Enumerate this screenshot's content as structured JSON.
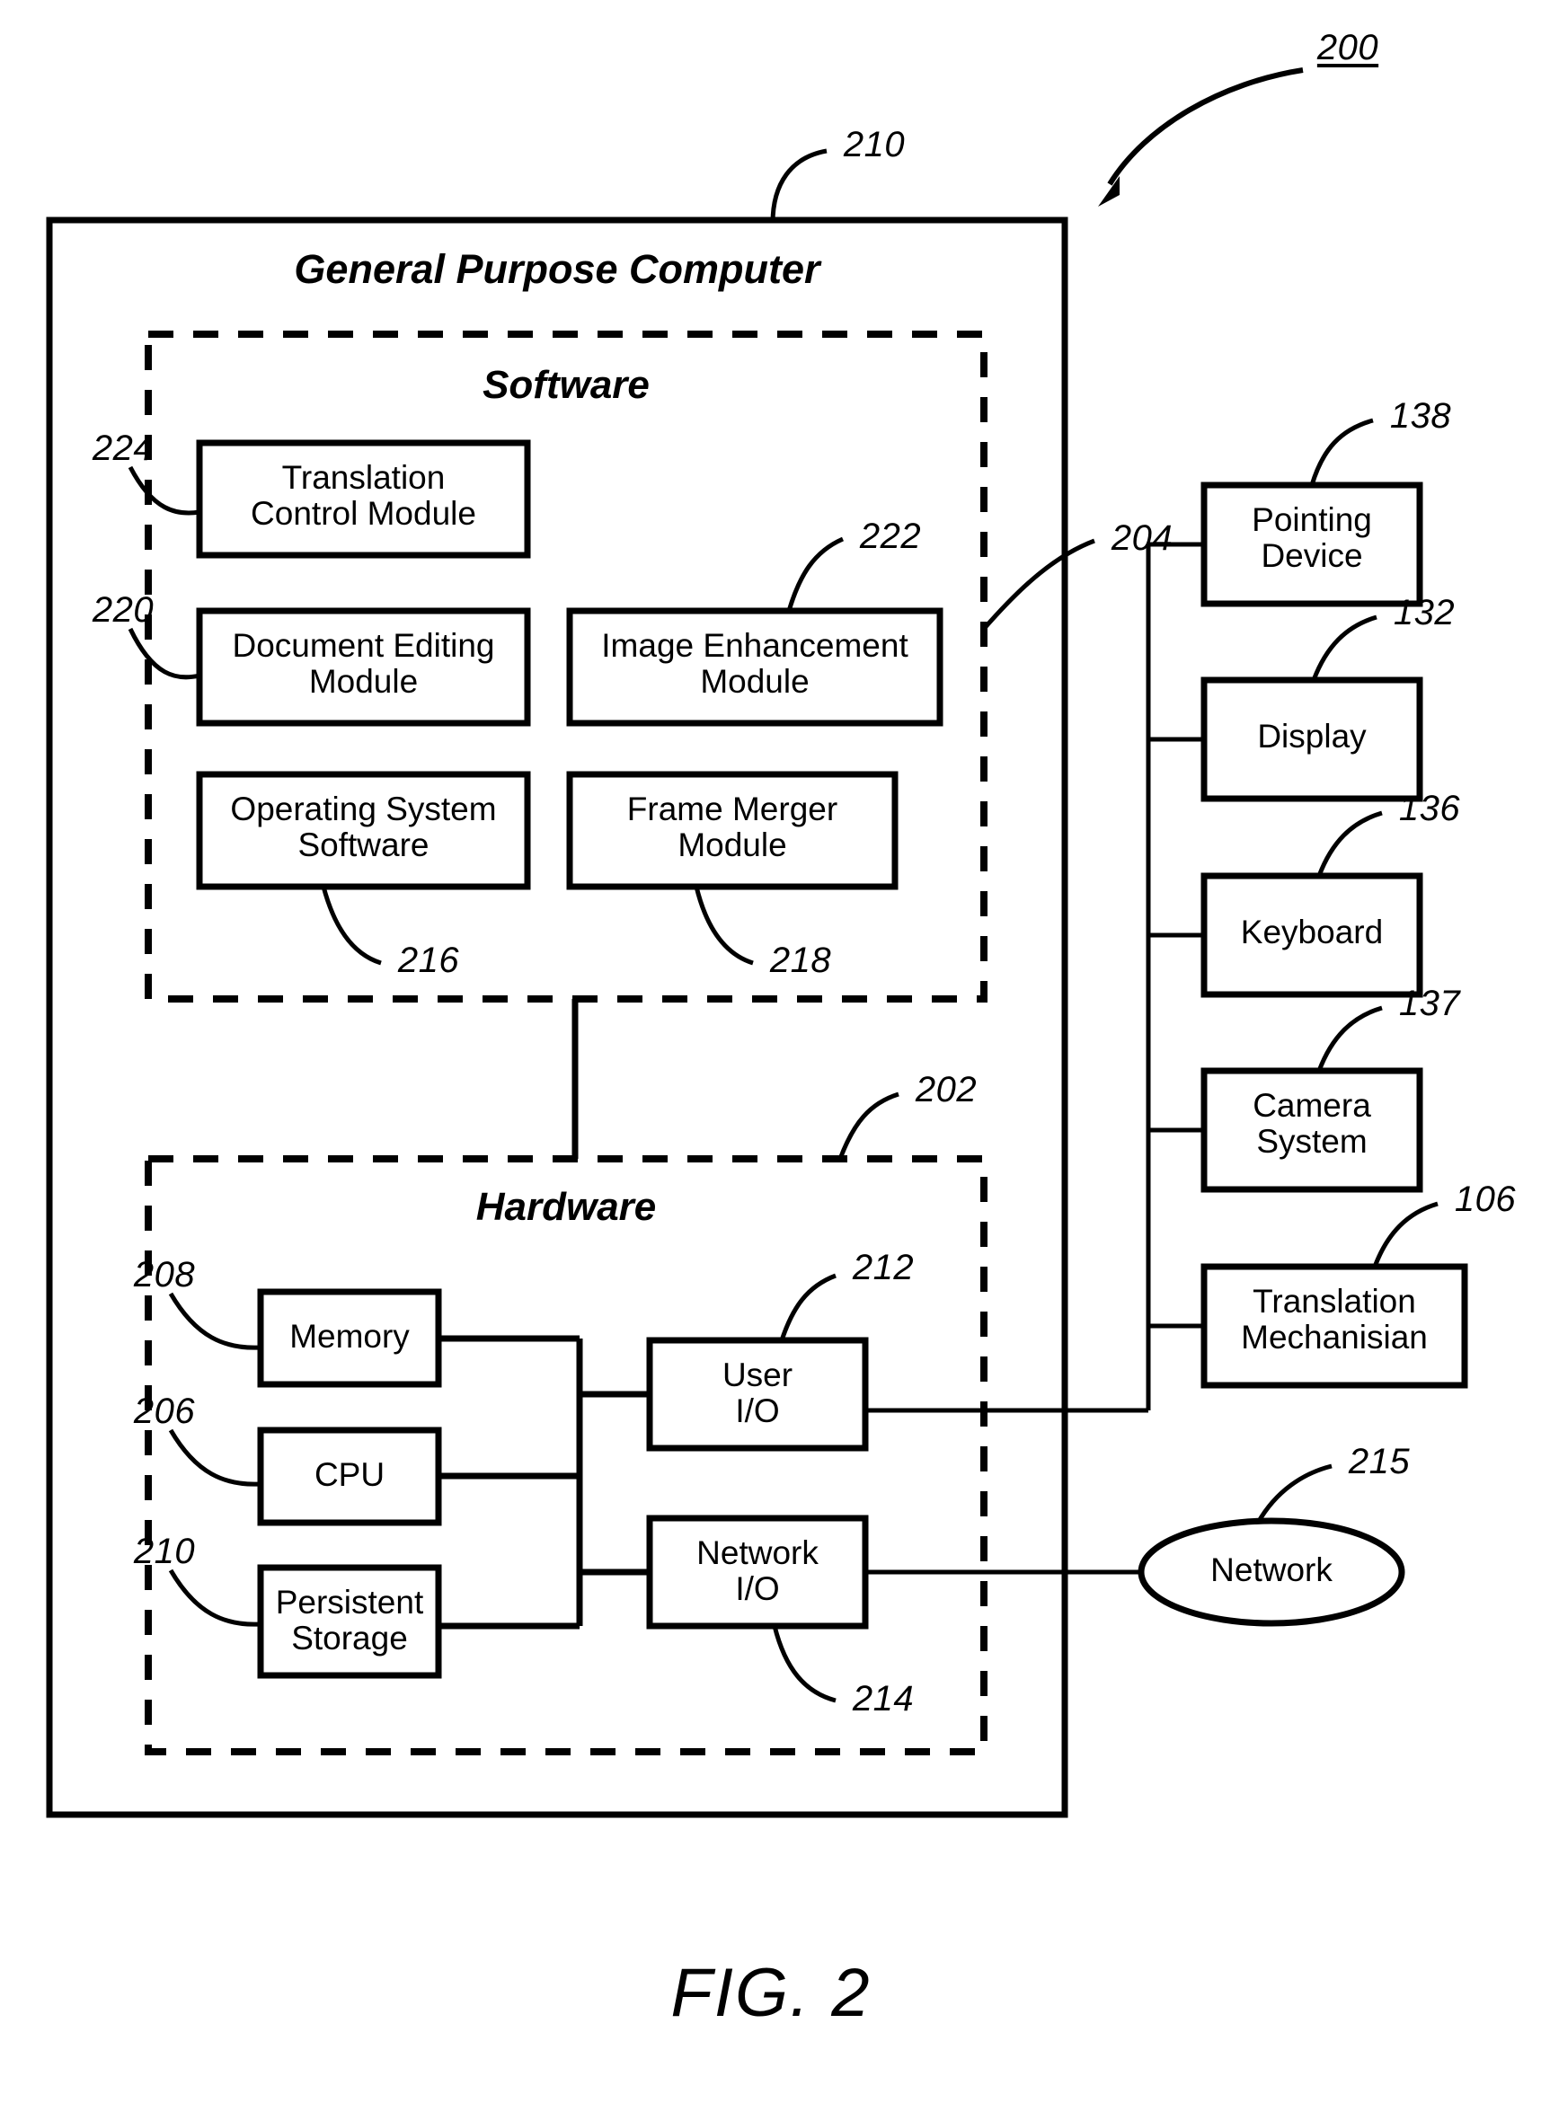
{
  "figure": {
    "caption": "FIG. 2",
    "top_ref": "200"
  },
  "outer": {
    "title": "General Purpose Computer",
    "ref": "210"
  },
  "software": {
    "title": "Software",
    "ref": "204",
    "modules": [
      {
        "label": "Translation\nControl Module",
        "ref": "224"
      },
      {
        "label": "Image Enhancement\nModule",
        "ref": "222"
      },
      {
        "label": "Document Editing\nModule",
        "ref": "220"
      },
      {
        "label": "Operating System\nSoftware",
        "ref": "216"
      },
      {
        "label": "Frame Merger\nModule",
        "ref": "218"
      }
    ]
  },
  "hardware": {
    "title": "Hardware",
    "ref": "202",
    "modules": [
      {
        "label": "Memory",
        "ref": "208"
      },
      {
        "label": "CPU",
        "ref": "206"
      },
      {
        "label": "Persistent\nStorage",
        "ref": "210"
      },
      {
        "label": "User\nI/O",
        "ref": "212"
      },
      {
        "label": "Network\nI/O",
        "ref": "214"
      }
    ]
  },
  "peripherals": [
    {
      "label": "Pointing\nDevice",
      "ref": "138"
    },
    {
      "label": "Display",
      "ref": "132"
    },
    {
      "label": "Keyboard",
      "ref": "136"
    },
    {
      "label": "Camera\nSystem",
      "ref": "137"
    },
    {
      "label": "Translation\nMechanisian",
      "ref": "106"
    }
  ],
  "network": {
    "label": "Network",
    "ref": "215"
  },
  "colors": {
    "stroke": "#000000",
    "background": "#ffffff"
  }
}
